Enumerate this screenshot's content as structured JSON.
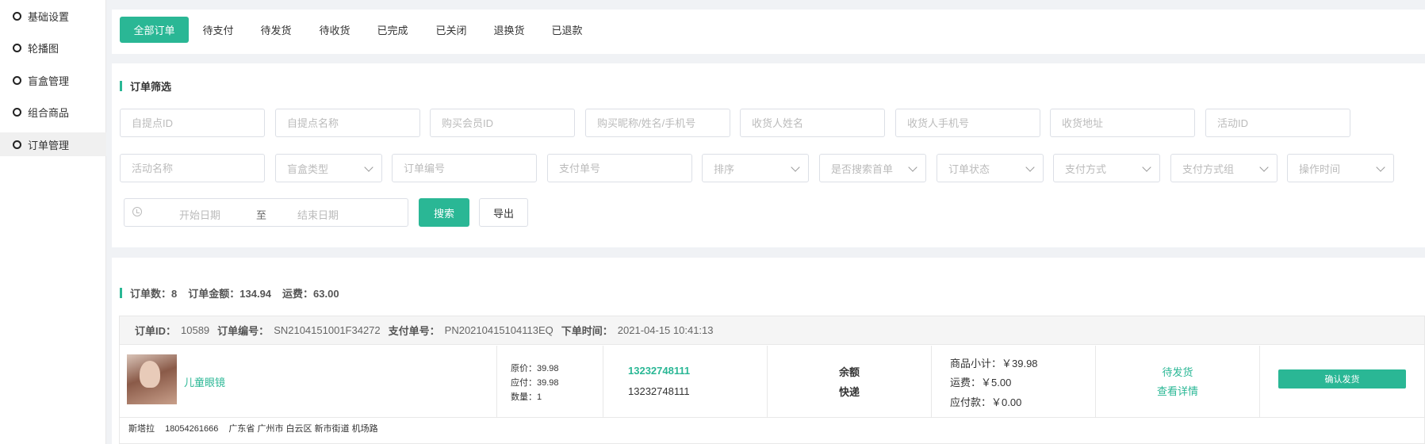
{
  "sidebar": {
    "items": [
      {
        "label": "基础设置"
      },
      {
        "label": "轮播图"
      },
      {
        "label": "盲盒管理"
      },
      {
        "label": "组合商品"
      },
      {
        "label": "订单管理"
      }
    ],
    "active_index": 4
  },
  "tabs": {
    "items": [
      {
        "label": "全部订单"
      },
      {
        "label": "待支付"
      },
      {
        "label": "待发货"
      },
      {
        "label": "待收货"
      },
      {
        "label": "已完成"
      },
      {
        "label": "已关闭"
      },
      {
        "label": "退换货"
      },
      {
        "label": "已退款"
      }
    ],
    "active_index": 0
  },
  "filter": {
    "title": "订单筛选",
    "row1": [
      {
        "placeholder": "自提点ID"
      },
      {
        "placeholder": "自提点名称"
      },
      {
        "placeholder": "购买会员ID"
      },
      {
        "placeholder": "购买昵称/姓名/手机号"
      },
      {
        "placeholder": "收货人姓名"
      },
      {
        "placeholder": "收货人手机号"
      },
      {
        "placeholder": "收货地址"
      },
      {
        "placeholder": "活动ID"
      }
    ],
    "row2": [
      {
        "placeholder": "活动名称"
      },
      {
        "placeholder": "盲盒类型",
        "select": true
      },
      {
        "placeholder": "订单编号"
      },
      {
        "placeholder": "支付单号"
      },
      {
        "placeholder": "排序",
        "select": true
      },
      {
        "placeholder": "是否搜索首单",
        "select": true
      },
      {
        "placeholder": "订单状态",
        "select": true
      },
      {
        "placeholder": "支付方式",
        "select": true
      },
      {
        "placeholder": "支付方式组",
        "select": true
      },
      {
        "placeholder": "操作时间",
        "select": true
      }
    ],
    "date_start_placeholder": "开始日期",
    "date_separator": "至",
    "date_end_placeholder": "结束日期",
    "search_label": "搜索",
    "export_label": "导出"
  },
  "summary": {
    "order_count_label": "订单数：",
    "order_count": "8",
    "amount_label": "订单金额：",
    "amount": "134.94",
    "freight_label": "运费：",
    "freight": "63.00"
  },
  "order": {
    "id_label": "订单ID：",
    "id": "10589",
    "no_label": "订单编号：",
    "no": "SN2104151001F34272",
    "pay_no_label": "支付单号：",
    "pay_no": "PN20210415104113EQ",
    "time_label": "下单时间：",
    "time": "2021-04-15 10:41:13",
    "product_name": "儿童眼镜",
    "original_price": "原价：39.98",
    "payable_price": "应付：39.98",
    "quantity": "数量：1",
    "phone1": "13232748111",
    "phone2": "13232748111",
    "pay_method": "余额",
    "delivery": "快递",
    "subtotal": "商品小计：￥39.98",
    "freight": "运费：￥5.00",
    "payable": "应付款：￥0.00",
    "status": "待发货",
    "detail_link": "查看详情",
    "ship_button": "确认发货",
    "recipient": "斯塔拉",
    "recipient_phone": "18054261666",
    "address": "广东省 广州市 白云区 新市街道 机场路"
  },
  "colors": {
    "accent": "#2ab795",
    "border": "#dcdfe6",
    "bg": "#f0f2f5"
  }
}
